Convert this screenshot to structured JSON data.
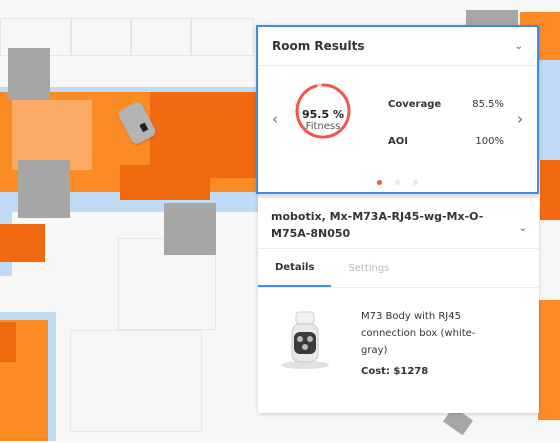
{
  "room_results": {
    "title": "Room Results",
    "fitness_value": "95.5 %",
    "fitness_label": "Fitness",
    "fitness_fraction": 0.955,
    "stats": [
      {
        "label": "Coverage",
        "value": "85.5%"
      },
      {
        "label": "AOI",
        "value": "100%"
      }
    ],
    "page_dots": 3,
    "active_dot": 0
  },
  "device": {
    "name": "mobotix, Mx-M73A-RJ45-wg-Mx-O-M75A-8N050",
    "tabs": [
      "Details",
      "Settings"
    ],
    "active_tab": 0,
    "description": "M73 Body with RJ45 connection box (white-gray)",
    "cost": "Cost: $1278"
  },
  "colors": {
    "accent_blue": "#3d8ce6",
    "ring_red": "#f0564a",
    "coverage_orange": "#fb8b24",
    "aoi_blue": "#bfdcf4"
  }
}
